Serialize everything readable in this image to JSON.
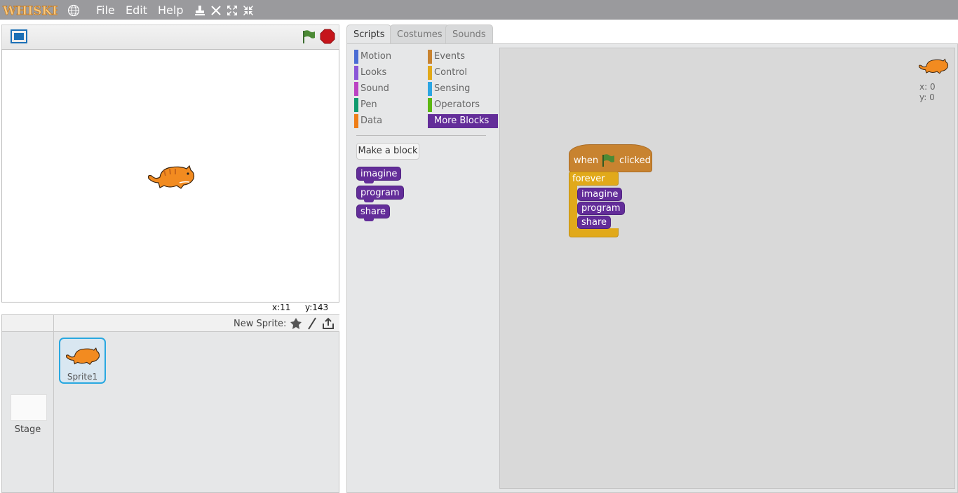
{
  "menubar": {
    "logo_text": "WHISKERS",
    "items": [
      "File",
      "Edit",
      "Help"
    ]
  },
  "stage": {
    "mouse_x": "x:11",
    "mouse_y": "y:143"
  },
  "corral": {
    "new_sprite_label": "New Sprite:",
    "sprites": [
      {
        "name": "Sprite1"
      }
    ],
    "stage_label": "Stage"
  },
  "tabs": [
    "Scripts",
    "Costumes",
    "Sounds"
  ],
  "categories": {
    "left": [
      {
        "label": "Motion",
        "color": "#4a6cd4"
      },
      {
        "label": "Looks",
        "color": "#8a55d7"
      },
      {
        "label": "Sound",
        "color": "#bb42c3"
      },
      {
        "label": "Pen",
        "color": "#0e9a6c"
      },
      {
        "label": "Data",
        "color": "#ee7d16"
      }
    ],
    "right": [
      {
        "label": "Events",
        "color": "#c88330"
      },
      {
        "label": "Control",
        "color": "#e1a91a"
      },
      {
        "label": "Sensing",
        "color": "#2ca5e2"
      },
      {
        "label": "Operators",
        "color": "#5cb712"
      },
      {
        "label": "More Blocks",
        "color": "#632d99",
        "selected": true
      }
    ]
  },
  "palette": {
    "make_block": "Make a block",
    "blocks": [
      "imagine",
      "program",
      "share"
    ]
  },
  "script": {
    "hat_when": "when",
    "hat_clicked": "clicked",
    "forever": "forever",
    "blocks": [
      "imagine",
      "program",
      "share"
    ],
    "sprite_x": "x: 0",
    "sprite_y": "y: 0"
  },
  "colors": {
    "events": "#c88330",
    "control": "#e1a91a",
    "more_blocks": "#632d99",
    "selection": "#29a8e0"
  }
}
